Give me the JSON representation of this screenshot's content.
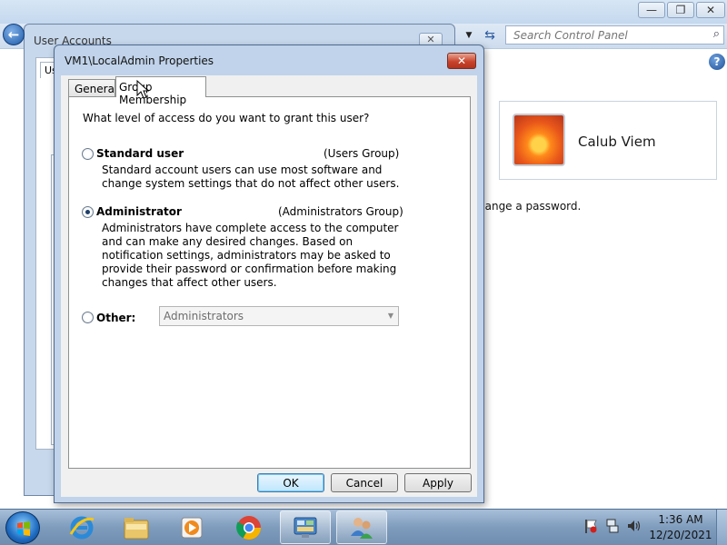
{
  "control_panel": {
    "search_placeholder": "Search Control Panel",
    "user_name": "Calub Viem",
    "change_password_text": "hange a password.",
    "controls": {
      "minimize": "—",
      "maximize": "❐",
      "close": "✕"
    }
  },
  "user_accounts_window": {
    "title": "User Accounts",
    "tab_stub": "Us"
  },
  "dialog": {
    "title": "VM1\\LocalAdmin Properties",
    "tabs": [
      {
        "label": "General",
        "selected": false
      },
      {
        "label": "Group Membership",
        "selected": true
      }
    ],
    "question": "What level of access do you want to grant this user?",
    "options": {
      "standard": {
        "label": "Standard user",
        "group": "(Users Group)",
        "description": "Standard account users can use most software and change system settings that do not affect other users.",
        "checked": false
      },
      "administrator": {
        "label": "Administrator",
        "group": "(Administrators Group)",
        "description": "Administrators have complete access to the computer and can make any desired changes. Based on notification settings, administrators may be asked to provide their password or confirmation before making changes that affect other users.",
        "checked": true
      },
      "other": {
        "label": "Other:",
        "select_value": "Administrators",
        "checked": false,
        "disabled": true
      }
    },
    "buttons": {
      "ok": "OK",
      "cancel": "Cancel",
      "apply": "Apply"
    }
  },
  "taskbar": {
    "apps": [
      "internet-explorer",
      "windows-explorer",
      "media-player",
      "chrome",
      "control-panel",
      "user-accounts"
    ],
    "time": "1:36 AM",
    "date": "12/20/2021"
  }
}
